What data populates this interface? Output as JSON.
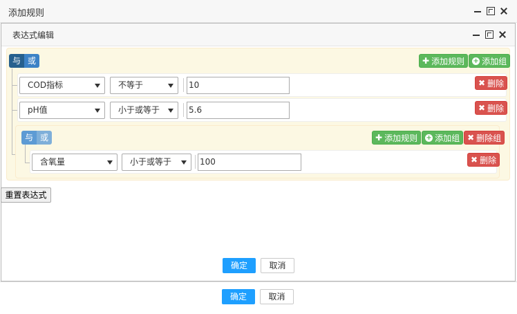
{
  "outer": {
    "title": "添加规则",
    "ok_label": "确定",
    "cancel_label": "取消"
  },
  "inner": {
    "title": "表达式编辑",
    "ok_label": "确定",
    "cancel_label": "取消"
  },
  "builder": {
    "and_label": "与",
    "or_label": "或",
    "add_rule_label": "添加规则",
    "add_group_label": "添加组",
    "delete_group_label": "删除组",
    "delete_label": "删除",
    "rules": [
      {
        "field": "COD指标",
        "operator": "不等于",
        "value": "10"
      },
      {
        "field": "pH值",
        "operator": "小于或等于",
        "value": "5.6"
      }
    ],
    "subgroup": {
      "rules": [
        {
          "field": "含氧量",
          "operator": "小于或等于",
          "value": "100"
        }
      ]
    }
  },
  "reset_label": "重置表达式",
  "colors": {
    "primary": "#1e9fff",
    "success": "#5cb85c",
    "danger": "#d9534f",
    "andor_active": "#26608e",
    "group_bg": "#fcf8e3"
  }
}
